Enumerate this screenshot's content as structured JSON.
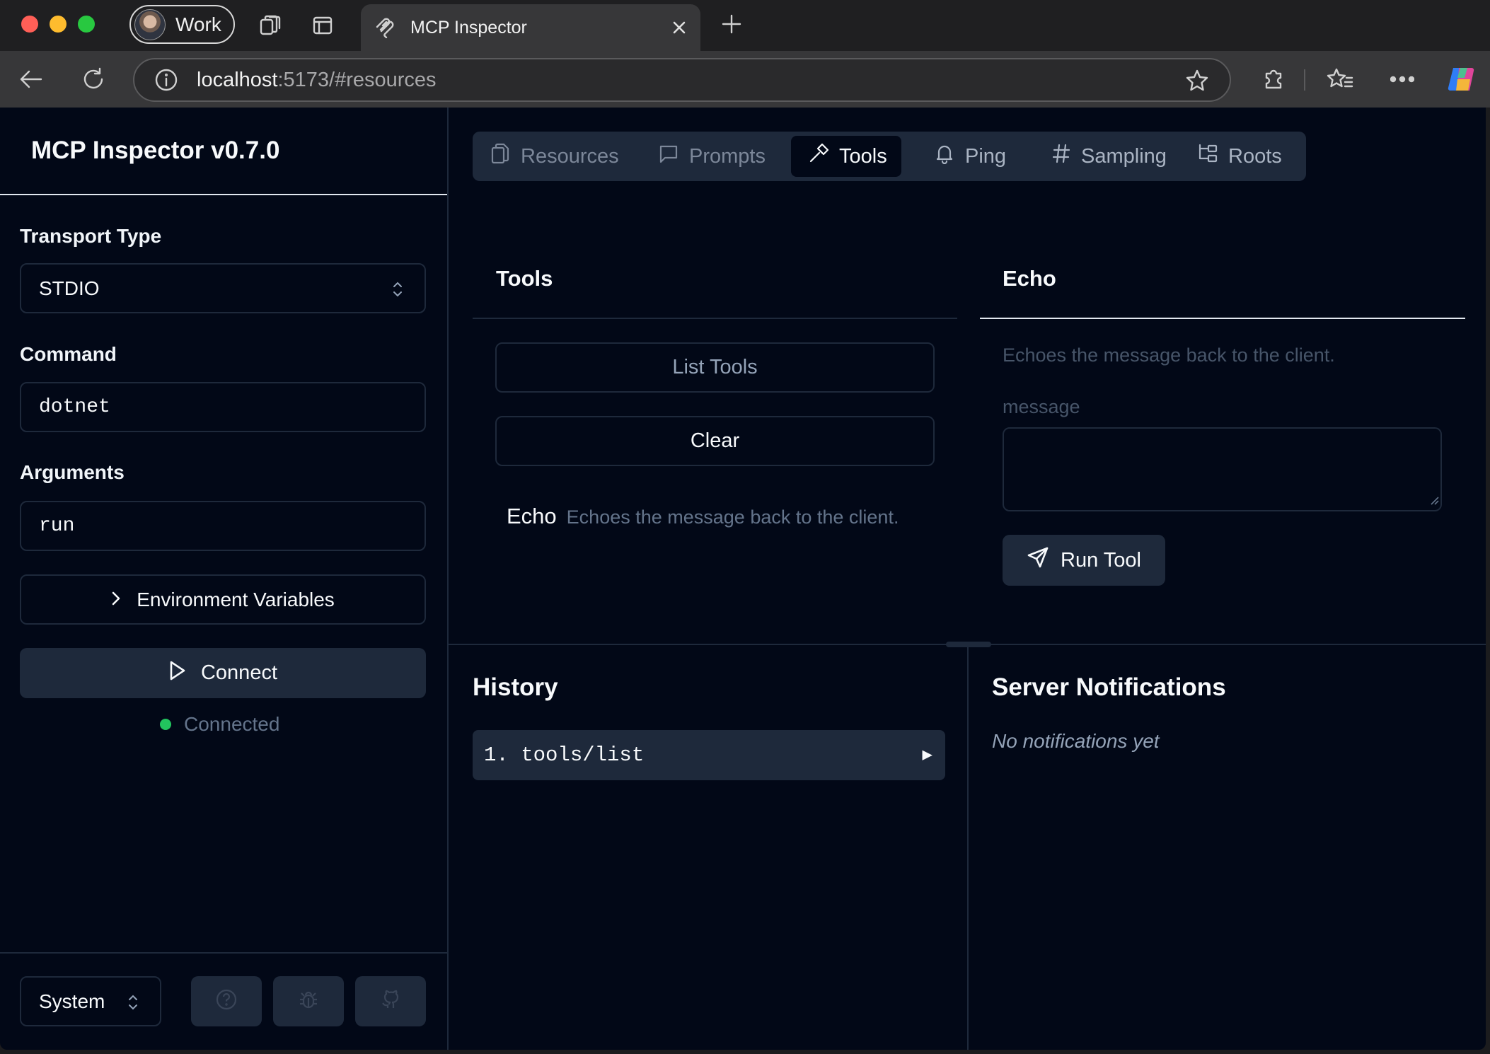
{
  "browser": {
    "profile_label": "Work",
    "tab_title": "MCP Inspector",
    "url_host": "localhost",
    "url_rest": ":5173/#resources"
  },
  "sidebar": {
    "title": "MCP Inspector v0.7.0",
    "transport_label": "Transport Type",
    "transport_value": "STDIO",
    "command_label": "Command",
    "command_value": "dotnet",
    "arguments_label": "Arguments",
    "arguments_value": "run",
    "env_label": "Environment Variables",
    "connect_label": "Connect",
    "status_text": "Connected",
    "theme_value": "System"
  },
  "tabs": [
    {
      "label": "Resources",
      "icon": "files-icon"
    },
    {
      "label": "Prompts",
      "icon": "message-square-icon"
    },
    {
      "label": "Tools",
      "icon": "hammer-icon"
    },
    {
      "label": "Ping",
      "icon": "bell-icon"
    },
    {
      "label": "Sampling",
      "icon": "hash-icon"
    },
    {
      "label": "Roots",
      "icon": "folder-tree-icon"
    }
  ],
  "active_tab": "Tools",
  "tools_panel": {
    "title": "Tools",
    "list_button": "List Tools",
    "clear_button": "Clear",
    "items": [
      {
        "name": "Echo",
        "description": "Echoes the message back to the client."
      }
    ]
  },
  "echo_panel": {
    "title": "Echo",
    "description": "Echoes the message back to the client.",
    "param_label": "message",
    "param_value": "",
    "run_button": "Run Tool"
  },
  "history": {
    "title": "History",
    "items": [
      {
        "label": "1. tools/list"
      }
    ]
  },
  "notifications": {
    "title": "Server Notifications",
    "empty_text": "No notifications yet"
  },
  "colors": {
    "background": "#020817",
    "border": "#1e293b",
    "status_connected": "#22c55e"
  }
}
